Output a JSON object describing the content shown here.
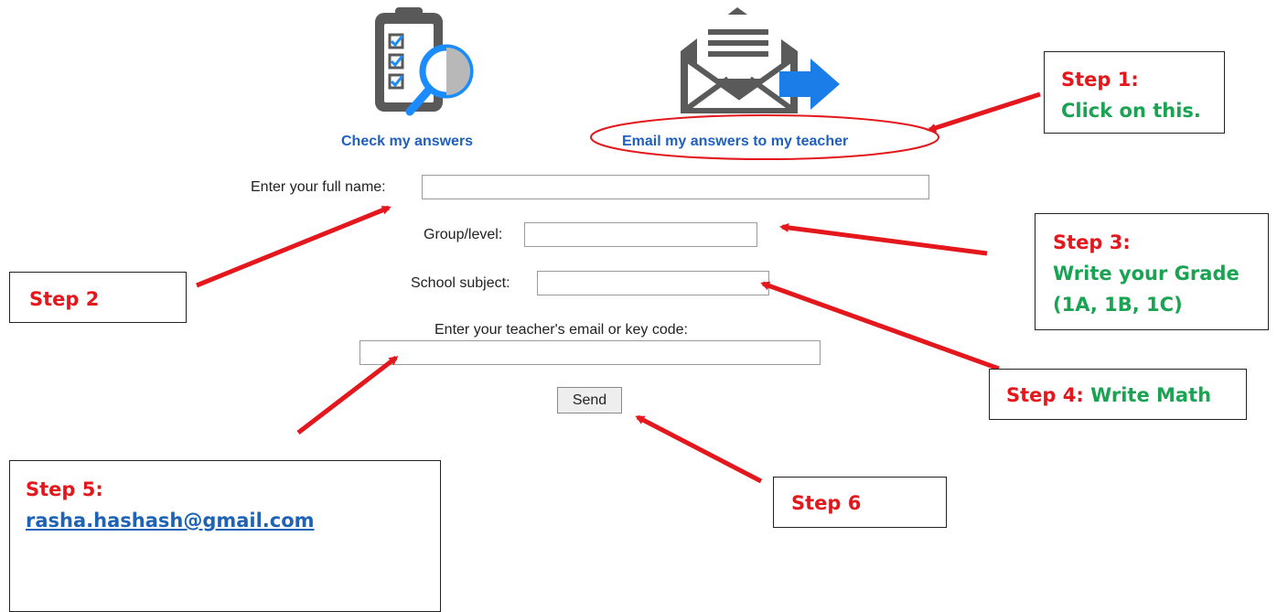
{
  "icons": {
    "check": "clipboard-magnifier-icon",
    "email": "envelope-arrow-icon"
  },
  "actions": {
    "check_label": "Check my answers",
    "email_label": "Email my answers to my teacher"
  },
  "form": {
    "name_label": "Enter your full name:",
    "name_value": "",
    "group_label": "Group/level:",
    "group_value": "",
    "subject_label": "School subject:",
    "subject_value": "",
    "teacher_label": "Enter your teacher's email or key code:",
    "teacher_value": "",
    "send_label": "Send"
  },
  "steps": {
    "step1": {
      "title": "Step 1:",
      "text": "Click on this."
    },
    "step2": {
      "title": "Step 2"
    },
    "step3": {
      "title": "Step 3:",
      "line1": "Write your Grade",
      "line2": "(1A, 1B, 1C)"
    },
    "step4": {
      "title": "Step 4:",
      "text": "Write Math"
    },
    "step5": {
      "title": "Step 5:",
      "email": "rasha.hashash@gmail.com"
    },
    "step6": {
      "title": "Step 6"
    }
  },
  "colors": {
    "annotation_red": "#e3171c",
    "annotation_green": "#1aa352",
    "link_blue": "#1f5fbf",
    "icon_gray": "#555555",
    "icon_blue": "#1a8cff"
  }
}
